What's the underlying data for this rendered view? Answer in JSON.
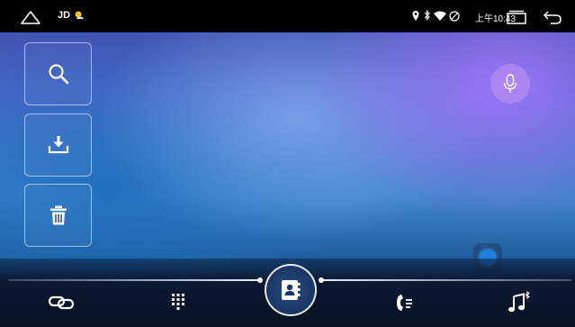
{
  "status_bar": {
    "app_label": "JD",
    "time": "上午10:43",
    "icons": [
      "home-icon",
      "weather-icon",
      "location-icon",
      "bluetooth-icon",
      "wifi-icon",
      "no-sim-icon",
      "recent-apps-icon",
      "back-icon"
    ]
  },
  "tools": [
    "search-icon",
    "download-icon",
    "trash-icon"
  ],
  "voice": {
    "icon": "microphone-icon"
  },
  "bottom_nav": {
    "items": [
      "link-icon",
      "dialpad-icon",
      "contacts-icon",
      "call-log-icon",
      "bluetooth-music-icon"
    ],
    "active": "contacts-icon",
    "accent": "#ffffff"
  },
  "colors": {
    "statusbar_bg": "#000000",
    "bottom_bg": "#081224",
    "float_dot": "#1e7fe0"
  }
}
